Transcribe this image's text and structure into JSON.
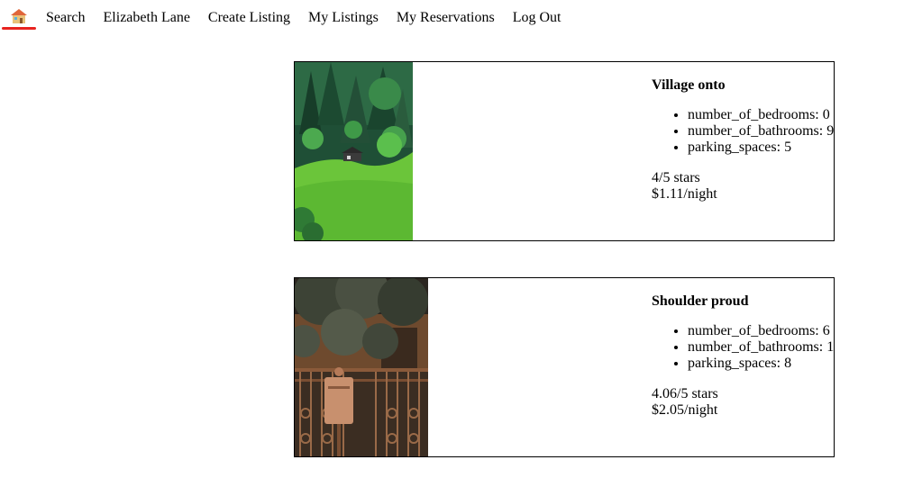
{
  "nav": {
    "home_icon": "house-icon",
    "accent_color": "#e8231f",
    "links": [
      {
        "label": "Search"
      },
      {
        "label": "Elizabeth Lane"
      },
      {
        "label": "Create Listing"
      },
      {
        "label": "My Listings"
      },
      {
        "label": "My Reservations"
      },
      {
        "label": "Log Out"
      }
    ]
  },
  "listings": [
    {
      "title": "Village onto",
      "specs": [
        "number_of_bedrooms: 0",
        "number_of_bathrooms: 9",
        "parking_spaces: 5"
      ],
      "rating": "4/5 stars",
      "price": "$1.11/night"
    },
    {
      "title": "Shoulder proud",
      "specs": [
        "number_of_bedrooms: 6",
        "number_of_bathrooms: 1",
        "parking_spaces: 8"
      ],
      "rating": "4.06/5 stars",
      "price": "$2.05/night"
    }
  ]
}
